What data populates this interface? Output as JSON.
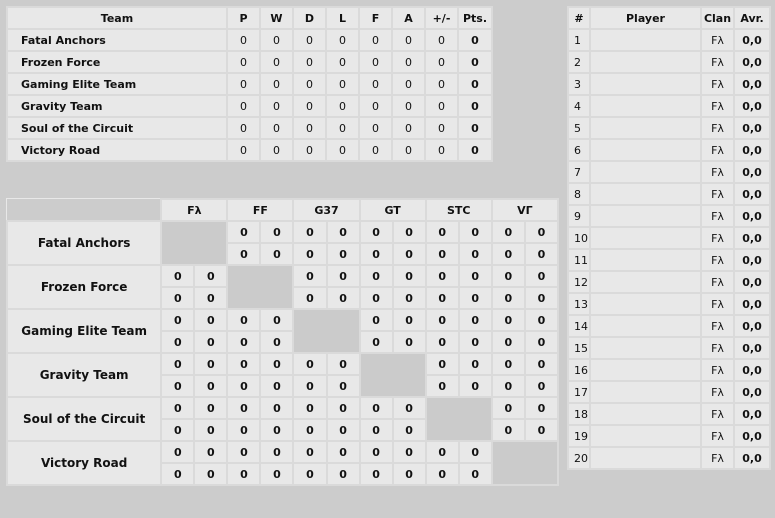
{
  "standings": {
    "headers": [
      "Team",
      "P",
      "W",
      "D",
      "L",
      "F",
      "A",
      "+/-",
      "Pts."
    ],
    "rows": [
      {
        "team": "Fatal Anchors",
        "P": "0",
        "W": "0",
        "D": "0",
        "L": "0",
        "F": "0",
        "A": "0",
        "diff": "0",
        "pts": "0"
      },
      {
        "team": "Frozen Force",
        "P": "0",
        "W": "0",
        "D": "0",
        "L": "0",
        "F": "0",
        "A": "0",
        "diff": "0",
        "pts": "0"
      },
      {
        "team": "Gaming Elite Team",
        "P": "0",
        "W": "0",
        "D": "0",
        "L": "0",
        "F": "0",
        "A": "0",
        "diff": "0",
        "pts": "0"
      },
      {
        "team": "Gravity Team",
        "P": "0",
        "W": "0",
        "D": "0",
        "L": "0",
        "F": "0",
        "A": "0",
        "diff": "0",
        "pts": "0"
      },
      {
        "team": "Soul of the Circuit",
        "P": "0",
        "W": "0",
        "D": "0",
        "L": "0",
        "F": "0",
        "A": "0",
        "diff": "0",
        "pts": "0"
      },
      {
        "team": "Victory Road",
        "P": "0",
        "W": "0",
        "D": "0",
        "L": "0",
        "F": "0",
        "A": "0",
        "diff": "0",
        "pts": "0"
      }
    ]
  },
  "cross": {
    "column_tags": [
      "Fλ",
      "FF",
      "G37",
      "GT",
      "STC",
      "VΓ"
    ],
    "teams": [
      "Fatal Anchors",
      "Frozen Force",
      "Gaming Elite Team",
      "Gravity Team",
      "Soul of the Circuit",
      "Victory Road"
    ],
    "score": "0"
  },
  "players": {
    "headers": [
      "#",
      "Player",
      "Clan",
      "Avr."
    ],
    "rows": [
      {
        "num": "1",
        "player": "",
        "clan": "Fλ",
        "avr": "0,0"
      },
      {
        "num": "2",
        "player": "",
        "clan": "Fλ",
        "avr": "0,0"
      },
      {
        "num": "3",
        "player": "",
        "clan": "Fλ",
        "avr": "0,0"
      },
      {
        "num": "4",
        "player": "",
        "clan": "Fλ",
        "avr": "0,0"
      },
      {
        "num": "5",
        "player": "",
        "clan": "Fλ",
        "avr": "0,0"
      },
      {
        "num": "6",
        "player": "",
        "clan": "Fλ",
        "avr": "0,0"
      },
      {
        "num": "7",
        "player": "",
        "clan": "Fλ",
        "avr": "0,0"
      },
      {
        "num": "8",
        "player": "",
        "clan": "Fλ",
        "avr": "0,0"
      },
      {
        "num": "9",
        "player": "",
        "clan": "Fλ",
        "avr": "0,0"
      },
      {
        "num": "10",
        "player": "",
        "clan": "Fλ",
        "avr": "0,0"
      },
      {
        "num": "11",
        "player": "",
        "clan": "Fλ",
        "avr": "0,0"
      },
      {
        "num": "12",
        "player": "",
        "clan": "Fλ",
        "avr": "0,0"
      },
      {
        "num": "13",
        "player": "",
        "clan": "Fλ",
        "avr": "0,0"
      },
      {
        "num": "14",
        "player": "",
        "clan": "Fλ",
        "avr": "0,0"
      },
      {
        "num": "15",
        "player": "",
        "clan": "Fλ",
        "avr": "0,0"
      },
      {
        "num": "16",
        "player": "",
        "clan": "Fλ",
        "avr": "0,0"
      },
      {
        "num": "17",
        "player": "",
        "clan": "Fλ",
        "avr": "0,0"
      },
      {
        "num": "18",
        "player": "",
        "clan": "Fλ",
        "avr": "0,0"
      },
      {
        "num": "19",
        "player": "",
        "clan": "Fλ",
        "avr": "0,0"
      },
      {
        "num": "20",
        "player": "",
        "clan": "Fλ",
        "avr": "0,0"
      }
    ]
  }
}
